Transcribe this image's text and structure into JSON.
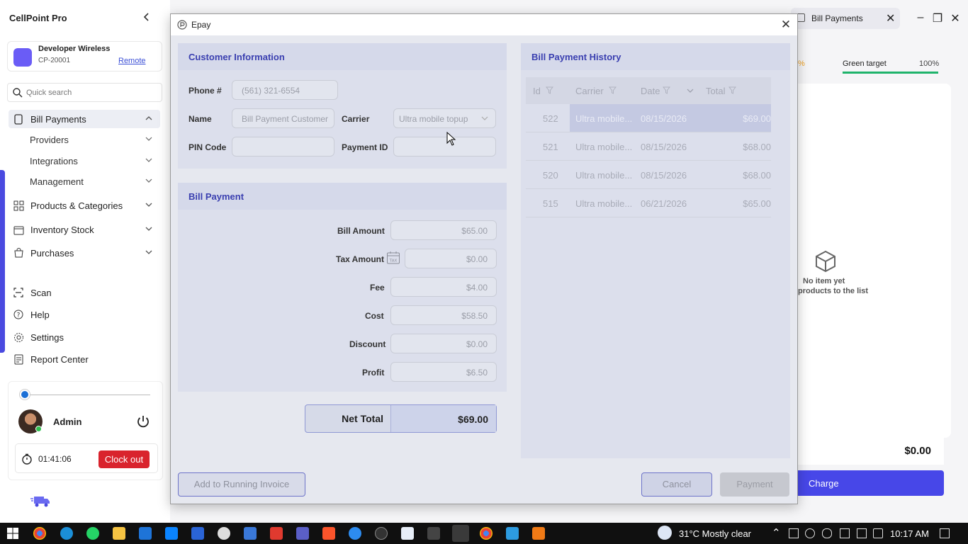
{
  "app": {
    "title": "CellPoint Pro",
    "store": {
      "name": "Developer Wireless",
      "id": "CP-20001",
      "remote_label": "Remote"
    },
    "search_placeholder": "Quick search"
  },
  "sidebar": {
    "bill_payments": "Bill Payments",
    "sub_items": [
      "Providers",
      "Integrations",
      "Management"
    ],
    "products": "Products & Categories",
    "inventory": "Inventory Stock",
    "purchases": "Purchases",
    "scan": "Scan",
    "help": "Help",
    "settings": "Settings",
    "report_center": "Report Center"
  },
  "user": {
    "name": "Admin",
    "timer": "01:41:06",
    "clock_out_label": "Clock out"
  },
  "background": {
    "active_tab": "Bill Payments",
    "target_pct_left": "%",
    "target_label": "Green target",
    "target_value": "100%",
    "no_item_line1": "No item yet",
    "no_item_line2": "products to the list",
    "total": "$0.00",
    "charge_label": "Charge"
  },
  "modal": {
    "title": "Epay",
    "customer": {
      "title": "Customer Information",
      "phone_label": "Phone #",
      "phone_value": "(561) 321-6554",
      "name_label": "Name",
      "name_value": "Bill Payment Customer",
      "carrier_label": "Carrier",
      "carrier_value": "Ultra mobile topup",
      "pin_label": "PIN Code",
      "pin_value": "",
      "payment_id_label": "Payment ID",
      "payment_id_value": ""
    },
    "bill": {
      "title": "Bill Payment",
      "bill_amount_label": "Bill Amount",
      "bill_amount": "$65.00",
      "tax_amount_label": "Tax Amount",
      "tax_amount": "$0.00",
      "fee_label": "Fee",
      "fee": "$4.00",
      "cost_label": "Cost",
      "cost": "$58.50",
      "discount_label": "Discount",
      "discount": "$0.00",
      "profit_label": "Profit",
      "profit": "$6.50",
      "tax_icon_text": "TAX"
    },
    "net_total_label": "Net Total",
    "net_total": "$69.00",
    "history": {
      "title": "Bill Payment History",
      "columns": {
        "id": "Id",
        "carrier": "Carrier",
        "date": "Date",
        "total": "Total"
      },
      "rows": [
        {
          "id": "522",
          "carrier": "Ultra mobile...",
          "date": "08/15/2026",
          "total": "$69.00"
        },
        {
          "id": "521",
          "carrier": "Ultra mobile...",
          "date": "08/15/2026",
          "total": "$68.00"
        },
        {
          "id": "520",
          "carrier": "Ultra mobile...",
          "date": "08/15/2026",
          "total": "$68.00"
        },
        {
          "id": "515",
          "carrier": "Ultra mobile...",
          "date": "06/21/2026",
          "total": "$65.00"
        }
      ]
    },
    "buttons": {
      "add_to_invoice": "Add to Running Invoice",
      "cancel": "Cancel",
      "payment": "Payment"
    }
  },
  "taskbar": {
    "weather": "31°C  Mostly clear",
    "time": "10:17 AM"
  },
  "colors": {
    "accent": "#4747e8",
    "section_title": "#3a3fb0",
    "clock_out": "#d9232d",
    "target": "#1fb36b"
  }
}
